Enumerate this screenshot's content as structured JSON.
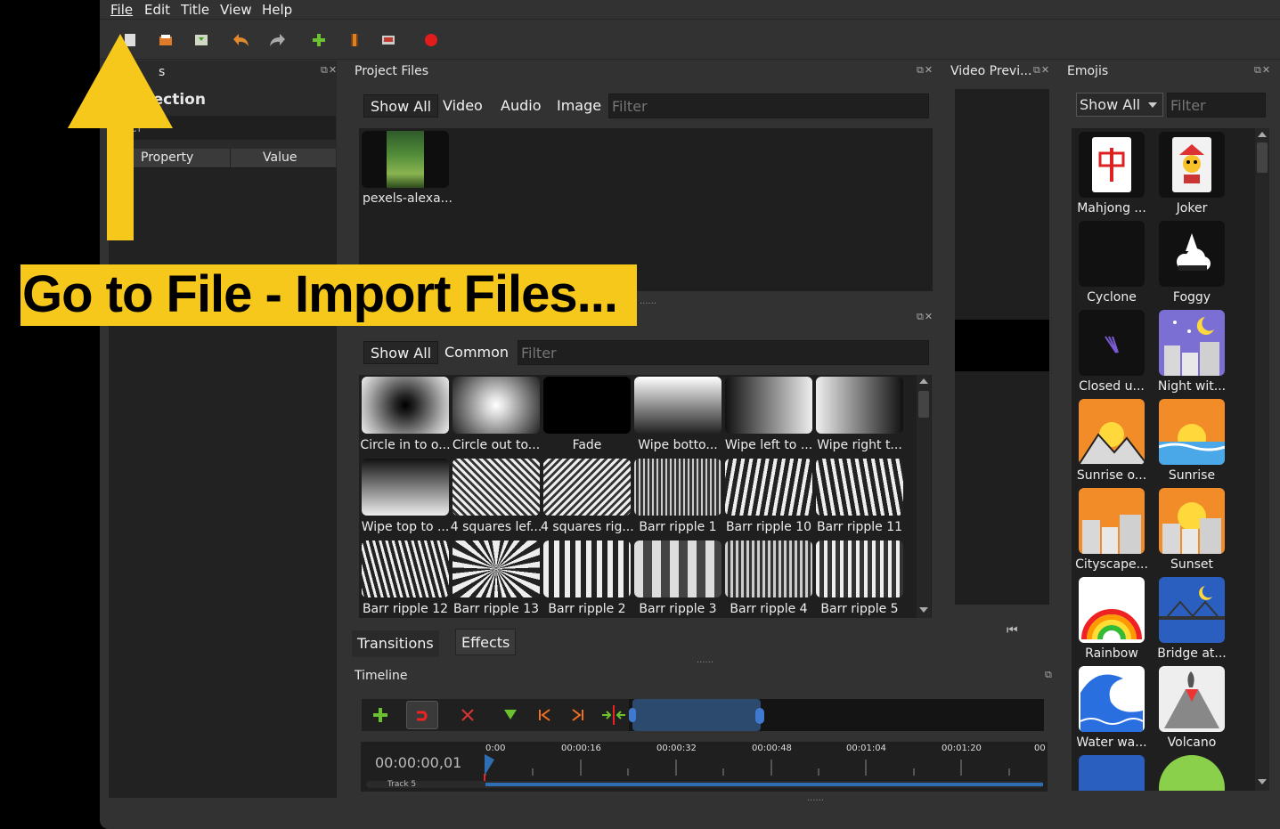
{
  "menu": [
    "File",
    "Edit",
    "Title",
    "View",
    "Help"
  ],
  "properties": {
    "title_partial": "s",
    "selection_partial": "Selection",
    "filter_partial": "ter",
    "col_property": "Property",
    "col_value": "Value"
  },
  "project_files": {
    "title": "Project Files",
    "filters": [
      "Show All",
      "Video",
      "Audio",
      "Image"
    ],
    "filter_placeholder": "Filter",
    "items": [
      {
        "name": "pexels-alexa..."
      }
    ]
  },
  "transitions_panel": {
    "filters": [
      "Show All",
      "Common"
    ],
    "filter_placeholder": "Filter",
    "items": [
      "Circle in to o...",
      "Circle out to...",
      "Fade",
      "Wipe botto...",
      "Wipe left to ...",
      "Wipe right t...",
      "Wipe top to ...",
      "4 squares lef...",
      "4 squares rig...",
      "Barr ripple 1",
      "Barr ripple 10",
      "Barr ripple 11",
      "Barr ripple 12",
      "Barr ripple 13",
      "Barr ripple 2",
      "Barr ripple 3",
      "Barr ripple 4",
      "Barr ripple 5"
    ],
    "tabs": [
      "Transitions",
      "Effects"
    ]
  },
  "video_preview": {
    "title": "Video Previ..."
  },
  "emojis": {
    "title": "Emojis",
    "dropdown": "Show All",
    "filter_placeholder": "Filter",
    "items": [
      "Mahjong ...",
      "Joker",
      "Cyclone",
      "Foggy",
      "Closed u...",
      "Night wit...",
      "Sunrise o...",
      "Sunrise",
      "Cityscape...",
      "Sunset",
      "Rainbow",
      "Bridge at...",
      "Water wa...",
      "Volcano"
    ]
  },
  "timeline": {
    "title": "Timeline",
    "timecode": "00:00:00,01",
    "ruler": [
      "0:00",
      "00:00:16",
      "00:00:32",
      "00:00:48",
      "00:01:04",
      "00:01:20",
      "00"
    ],
    "track": "Track 5"
  },
  "overlay": {
    "text": "Go to File - Import Files..."
  },
  "colors": {
    "accent": "#f7c81c",
    "bg": "#323232",
    "panel": "#1f1f1f",
    "playhead": "#2f6eb4"
  }
}
